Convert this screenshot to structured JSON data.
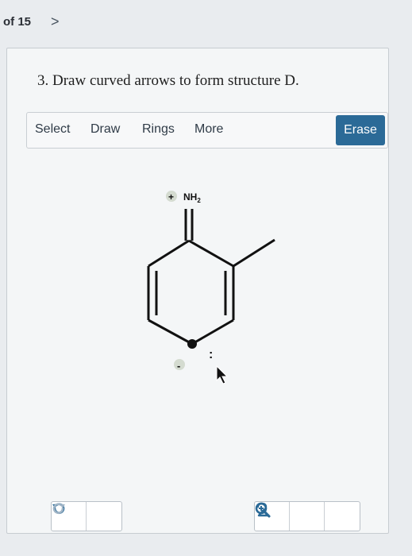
{
  "nav": {
    "page_indicator": "of 15",
    "next_icon": "chevron-right-icon"
  },
  "question": {
    "text": "3. Draw curved arrows to form structure D."
  },
  "toolbar": {
    "select_label": "Select",
    "draw_label": "Draw",
    "rings_label": "Rings",
    "more_label": "More",
    "erase_label": "Erase",
    "erase_color": "#2b6a97"
  },
  "structure": {
    "plus_charge": "+",
    "amine_group": "NH",
    "amine_subscript": "2",
    "minus_charge": "-",
    "lone_pair": ":"
  },
  "controls": {
    "undo_icon": "undo-icon",
    "redo_icon": "redo-icon",
    "zoom_in_icon": "zoom-in-icon",
    "reset_icon": "reset-view-icon",
    "zoom_out_icon": "zoom-out-icon",
    "icon_color": "#2b6a97"
  }
}
